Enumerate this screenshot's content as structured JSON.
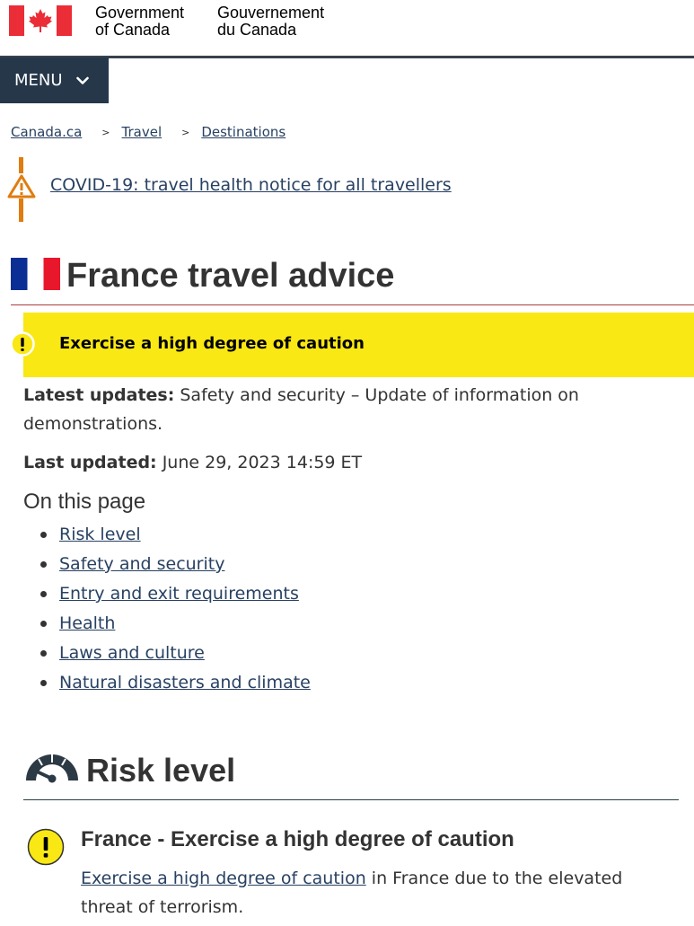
{
  "header": {
    "signature_en": [
      "Government",
      "of Canada"
    ],
    "signature_fr": [
      "Gouvernement",
      "du Canada"
    ],
    "menu_label": "MENU"
  },
  "breadcrumb": {
    "items": [
      "Canada.ca",
      "Travel",
      "Destinations"
    ],
    "separator": ">"
  },
  "notice": {
    "link_text": "COVID-19: travel health notice for all travellers",
    "accent_color": "#e07d10"
  },
  "page": {
    "title": "France travel advice",
    "caution_banner": "Exercise a high degree of caution",
    "banner_color": "#f9e813",
    "latest_updates_label": "Latest updates:",
    "latest_updates_text": " Safety and security – Update of information on demonstrations.",
    "last_updated_label": "Last updated:",
    "last_updated_value": " June 29, 2023 14:59 ET"
  },
  "on_this_page": {
    "title": "On this page",
    "links": [
      "Risk level",
      "Safety and security",
      "Entry and exit requirements",
      "Health",
      "Laws and culture",
      "Natural disasters and climate"
    ]
  },
  "risk_level": {
    "title": "Risk level",
    "subtitle": "France - Exercise a high degree of caution",
    "link_text": "Exercise a high degree of caution",
    "desc_rest": " in France due to the elevated threat of terrorism."
  }
}
